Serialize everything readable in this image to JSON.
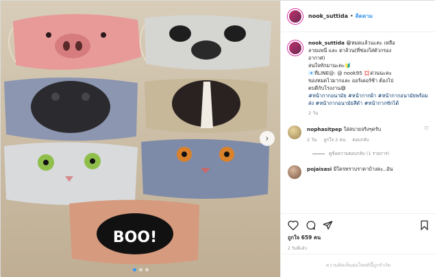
{
  "post": {
    "username": "nook_suttida",
    "separator": "•",
    "follow_label": "ติดตาม",
    "caption_user": "nook_suttida",
    "caption_lines": [
      "😁หมดแล้วนะคะ เหลือ",
      "ลายแพนี่ และ ตาล้วน(ที่ช่องใส่ตัวกรอง",
      "อากาศ)",
      "สนใจทักมานะคะ🔰",
      "📧ทีLINE@: @ nook95 💢ด่วนนะคะ",
      "ของหมดไวมากและ ออร์เดอร์ช้า ต้องไป",
      "ตบตีกับโรงงาน😅"
    ],
    "hashtags": "#หน้ากากอนามัย #หน้ากากผ้า #หน้ากากอนามัยพร้อมส่ง #หน้ากากอนามัยสีดำ #หน้ากากซักได้",
    "caption_time": "2 วัน",
    "likes": "ถูกใจ 659 คน",
    "date": "2 วันที่แล้ว",
    "add_comment_placeholder": "ความคิดเห็นต่อโพสต์นี้ถูกจำกัด"
  },
  "comments": [
    {
      "user": "nophasitpep",
      "text": "ใส่สบายจริงๆครับ",
      "time": "2 วัน",
      "likes": "ถูกใจ 2 คน",
      "reply_label": "ตอบกลับ"
    },
    {
      "user": "pojaisasi",
      "text": "มีใครทราบราคาบ้างคะ..อัน"
    }
  ],
  "view_replies": "ดูข้อความตอบกลับ (1 รายการ)",
  "icons": {
    "like": "heart-icon",
    "comment": "comment-icon",
    "share": "share-icon",
    "save": "bookmark-icon"
  },
  "mask_text": "BOO!"
}
